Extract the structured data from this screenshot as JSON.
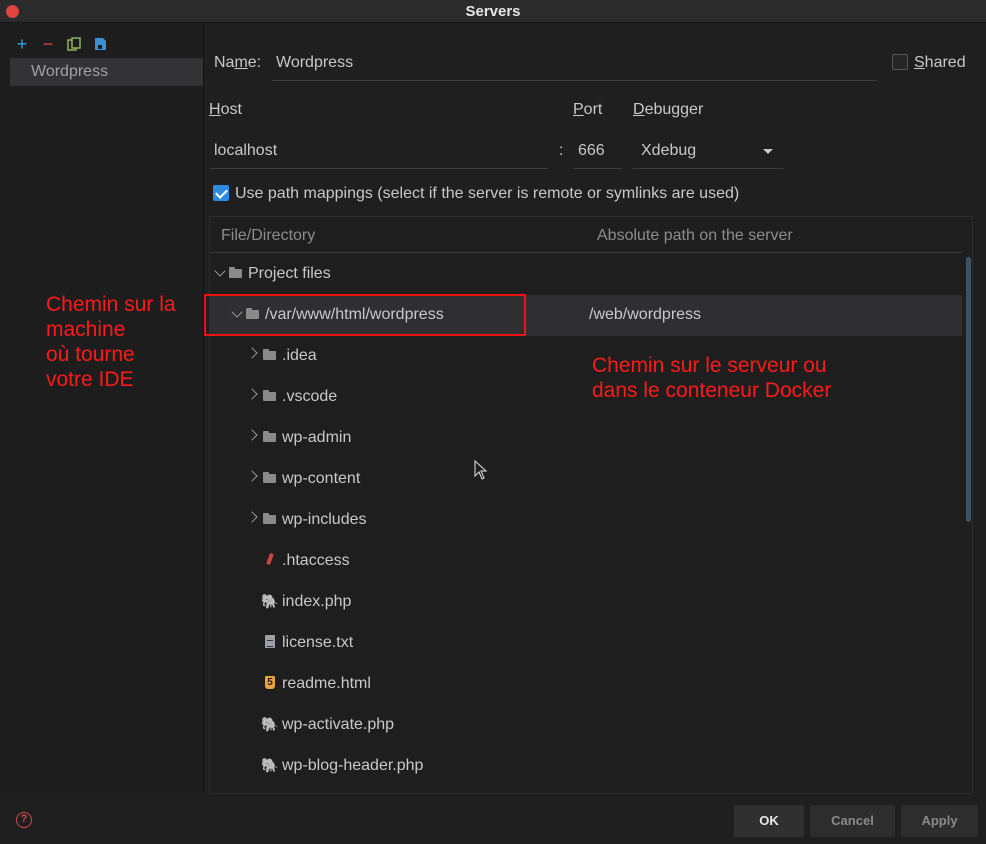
{
  "window": {
    "title": "Servers"
  },
  "toolbar": {
    "add_icon": "plus-icon",
    "remove_icon": "minus-icon",
    "copy_icon": "copy-icon",
    "save_icon": "save-icon"
  },
  "servers": [
    {
      "label": "Wordpress",
      "selected": true
    }
  ],
  "form": {
    "name_label": "Name:",
    "name_value": "Wordpress",
    "shared_label": "Shared",
    "shared_checked": false,
    "host_label": "Host",
    "host_value": "localhost",
    "port_separator": ":",
    "port_label": "Port",
    "port_value": "666",
    "debugger_label": "Debugger",
    "debugger_value": "Xdebug",
    "use_path_mappings_label": "Use path mappings (select if the server is remote or symlinks are used)",
    "use_path_mappings_checked": true
  },
  "table": {
    "headers": [
      "File/Directory",
      "Absolute path on the server"
    ],
    "rows": [
      {
        "name": "Project files",
        "type": "folder",
        "expanded": true,
        "path": ""
      },
      {
        "name": "/var/www/html/wordpress",
        "type": "folder",
        "expanded": true,
        "path": "/web/wordpress",
        "selected": true
      },
      {
        "name": ".idea",
        "type": "folder",
        "expanded": false,
        "path": ""
      },
      {
        "name": ".vscode",
        "type": "folder",
        "expanded": false,
        "path": ""
      },
      {
        "name": "wp-admin",
        "type": "folder",
        "expanded": false,
        "path": ""
      },
      {
        "name": "wp-content",
        "type": "folder",
        "expanded": false,
        "path": ""
      },
      {
        "name": "wp-includes",
        "type": "folder",
        "expanded": false,
        "path": ""
      },
      {
        "name": ".htaccess",
        "type": "htaccess",
        "path": ""
      },
      {
        "name": "index.php",
        "type": "php",
        "path": ""
      },
      {
        "name": "license.txt",
        "type": "text",
        "path": ""
      },
      {
        "name": "readme.html",
        "type": "html",
        "path": ""
      },
      {
        "name": "wp-activate.php",
        "type": "php",
        "path": ""
      },
      {
        "name": "wp-blog-header.php",
        "type": "php",
        "path": ""
      }
    ]
  },
  "annotations": {
    "local_lines": [
      "Chemin sur la",
      "machine",
      "où tourne",
      "votre IDE"
    ],
    "server_lines": [
      "Chemin sur le serveur ou",
      "dans le conteneur Docker"
    ],
    "color": "#ff1a1a"
  },
  "buttons": {
    "ok": "OK",
    "cancel": "Cancel",
    "apply": "Apply"
  },
  "colors": {
    "accent": "#2e8ce0",
    "selection": "#2f2f31",
    "annotation": "#ff1a1a"
  }
}
